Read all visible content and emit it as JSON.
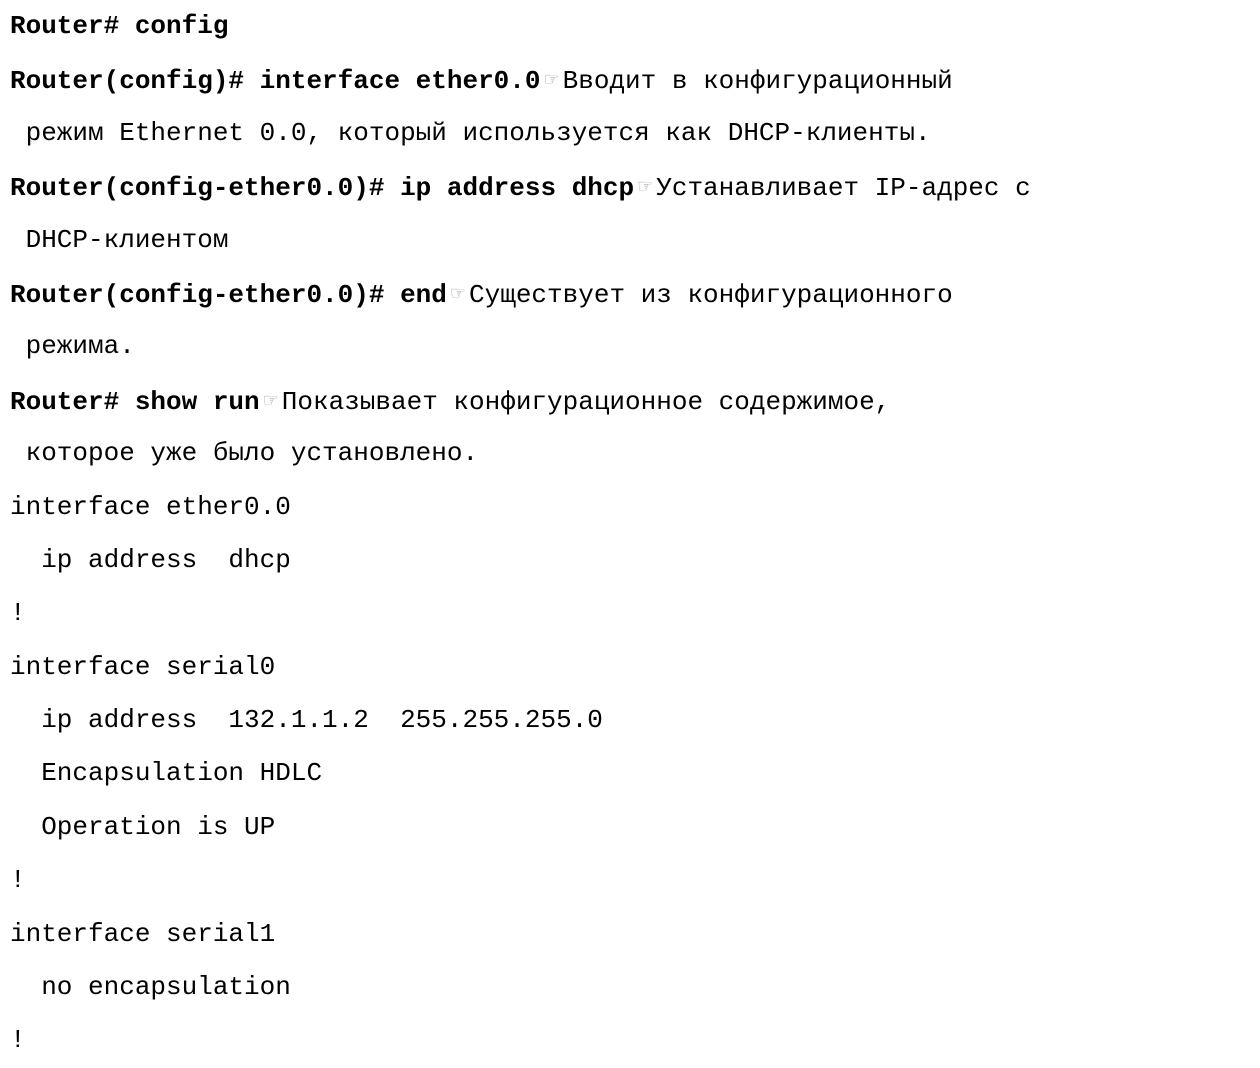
{
  "lines": [
    {
      "command": "Router# config",
      "note": ""
    },
    {
      "command": "Router(config)# interface ether0.0",
      "note": "Вводит в конфигурационный"
    },
    {
      "command": "",
      "note": " режим Ethernet 0.0, который используется как DHCP-клиенты."
    },
    {
      "command": "Router(config-ether0.0)# ip address dhcp",
      "note": "Устанавливает IP-адрес с"
    },
    {
      "command": "",
      "note": " DHCP-клиентом"
    },
    {
      "command": "Router(config-ether0.0)# end",
      "note": "Существует из конфигурационного"
    },
    {
      "command": "",
      "note": " режима."
    },
    {
      "command": "Router# show run",
      "note": "Показывает конфигурационное содержимое,"
    },
    {
      "command": "",
      "note": " которое уже было установлено."
    }
  ],
  "pointer_icon": "☞",
  "config_output": [
    "interface ether0.0",
    "  ip address  dhcp",
    "!",
    "interface serial0",
    "  ip address  132.1.1.2  255.255.255.0",
    "  Encapsulation HDLC",
    "  Operation is UP",
    "!",
    "interface serial1",
    "  no encapsulation",
    "!"
  ]
}
